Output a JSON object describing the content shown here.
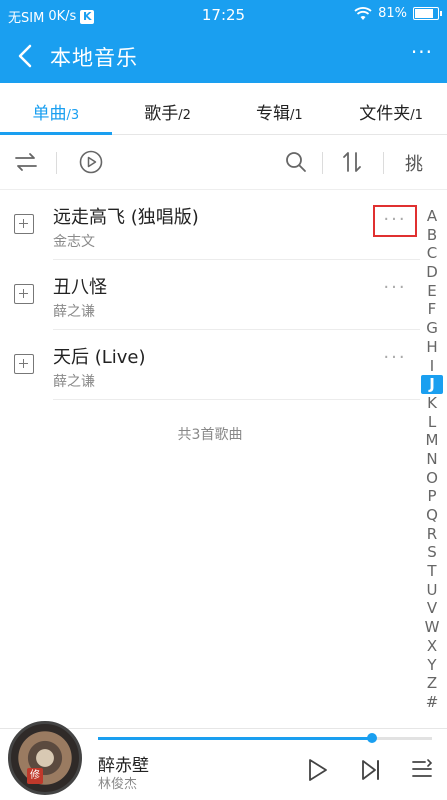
{
  "status": {
    "carrier": "无SIM",
    "speed": "0K/s",
    "badge": "K",
    "time": "17:25",
    "battery": "81%",
    "battery_level": 0.81
  },
  "header": {
    "title": "本地音乐",
    "more": "···"
  },
  "tabs": [
    {
      "label": "单曲",
      "count": "/3",
      "active": true
    },
    {
      "label": "歌手",
      "count": "/2",
      "active": false
    },
    {
      "label": "专辑",
      "count": "/1",
      "active": false
    },
    {
      "label": "文件夹",
      "count": "/1",
      "active": false
    }
  ],
  "toolbar": {
    "icons": [
      "shuffle-icon",
      "play-circle-icon",
      "search-icon",
      "sort-icon"
    ],
    "batch_label": "挑"
  },
  "songs": [
    {
      "title": "远走高飞 (独唱版)",
      "artist": "金志文",
      "more": "···"
    },
    {
      "title": "丑八怪",
      "artist": "薛之谦",
      "more": "···"
    },
    {
      "title": "天后 (Live)",
      "artist": "薛之谦",
      "more": "···"
    }
  ],
  "total_text": "共3首歌曲",
  "alpha_index": [
    "A",
    "B",
    "C",
    "D",
    "E",
    "F",
    "G",
    "H",
    "I",
    "J",
    "K",
    "L",
    "M",
    "N",
    "O",
    "P",
    "Q",
    "R",
    "S",
    "T",
    "U",
    "V",
    "W",
    "X",
    "Y",
    "Z",
    "#"
  ],
  "alpha_selected": "J",
  "player": {
    "title": "醉赤壁",
    "artist": "林俊杰",
    "progress": 0.82,
    "cover_tag": "修"
  },
  "colors": {
    "accent": "#1a9ff0",
    "highlight_box": "#e03030"
  }
}
